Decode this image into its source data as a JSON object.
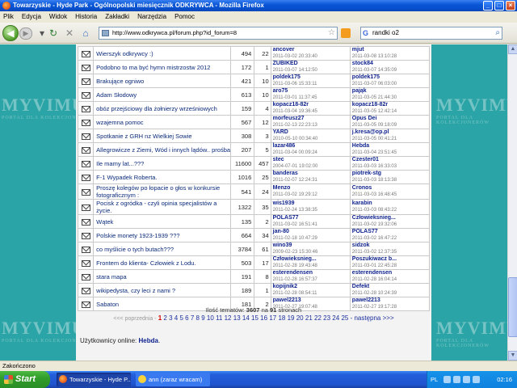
{
  "window": {
    "title": "Towarzyskie - Hyde Park - Ogólnopolski miesięcznik ODKRYWCA - Mozilla Firefox"
  },
  "menu": [
    "Plik",
    "Edycja",
    "Widok",
    "Historia",
    "Zakładki",
    "Narzędzia",
    "Pomoc"
  ],
  "toolbar": {
    "url": "http://www.odkrywca.pl/forum.php?id_forum=8",
    "search_value": "randki o2"
  },
  "side_logo": {
    "main": "MYVIMU",
    "sub": "PORTAL DLA KOLEKCJONERÓW"
  },
  "topics": [
    {
      "title": "Wierszyk odkrywcy :)",
      "views": "494",
      "replies": "22",
      "author": "ancover",
      "author_date": "2011-03-02 20:33:40",
      "last": "mjut",
      "last_date": "2011-03-08 13:10:28"
    },
    {
      "title": "Podobno to ma być hymn mistrzostw 2012",
      "views": "172",
      "replies": "1",
      "author": "ZUBIKED",
      "author_date": "2011-03-07 14:12:50",
      "last": "stock84",
      "last_date": "2011-03-07 14:35:09"
    },
    {
      "title": "Brakujące ogniwo",
      "views": "421",
      "replies": "10",
      "author": "poldek175",
      "author_date": "2011-03-06 15:33:11",
      "last": "poldek175",
      "last_date": "2011-03-07 06:03:00"
    },
    {
      "title": "Adam Słodowy",
      "views": "613",
      "replies": "10",
      "author": "aro75",
      "author_date": "2011-03-01 11:37:45",
      "last": "pająk",
      "last_date": "2011-03-05 21:44:30"
    },
    {
      "title": "obóz przejściowy dla żołnierzy wrześniowych",
      "views": "159",
      "replies": "4",
      "author": "kopacz18-82r",
      "author_date": "2011-03-04 19:36:45",
      "last": "kopacz18-82r",
      "last_date": "2011-03-05 12:42:14"
    },
    {
      "title": "wzajemna pomoc",
      "views": "567",
      "replies": "12",
      "author": "morfeusz27",
      "author_date": "2011-02-13 22:23:13",
      "last": "Opus Dei",
      "last_date": "2011-03-05 09:18:09"
    },
    {
      "title": "Spotkanie z GRH nz Wielkiej Sowie",
      "views": "308",
      "replies": "3",
      "author": "YARD",
      "author_date": "2010-05-10 00:34:40",
      "last": "j.kresa@op.pl",
      "last_date": "2011-03-05 00:41:21"
    },
    {
      "title": "Allegrowicze z Ziemi, Wód i innych lądów.. prośba",
      "views": "207",
      "replies": "5",
      "author": "lazar486",
      "author_date": "2011-03-04 00:09:24",
      "last": "Hebda",
      "last_date": "2011-03-04 23:51:45"
    },
    {
      "title": "Ile mamy lat...???",
      "views": "11600",
      "replies": "457",
      "author": "stec",
      "author_date": "2004-07-01 19:02:00",
      "last": "Czester01",
      "last_date": "2011-03-03 16:33:03"
    },
    {
      "title": "F-1 Wypadek Roberta.",
      "views": "1016",
      "replies": "25",
      "author": "banderas",
      "author_date": "2011-02-07 12:24:31",
      "last": "piotrek-stg",
      "last_date": "2011-03-03 18:13:38"
    },
    {
      "title": "Proszę kolegów po łopacie o głos w konkursie fotograficznym :",
      "views": "541",
      "replies": "24",
      "author": "Menzo",
      "author_date": "2011-03-02 19:29:12",
      "last": "Cronos",
      "last_date": "2011-03-03 16:48:45"
    },
    {
      "title": "Pocisk z ogródka - czyli opinia specjalistów a życie.",
      "views": "1322",
      "replies": "35",
      "author": "wis1939",
      "author_date": "2011-02-24 13:38:35",
      "last": "karabin",
      "last_date": "2011-03-03 08:43:22"
    },
    {
      "title": "Wątek",
      "views": "135",
      "replies": "2",
      "author": "POLAS77",
      "author_date": "2011-03-02 16:51:41",
      "last": "Człowieksnieg...",
      "last_date": "2011-03-02 19:32:06"
    },
    {
      "title": "Polskie monety 1923-1939 ???",
      "views": "664",
      "replies": "34",
      "author": "jan-80",
      "author_date": "2011-02-18 10:47:29",
      "last": "POLAS77",
      "last_date": "2011-03-02 16:47:22"
    },
    {
      "title": "co myślicie o tych butach???",
      "views": "3784",
      "replies": "61",
      "author": "wino39",
      "author_date": "2009-02-23 15:30:46",
      "last": "sidzok",
      "last_date": "2011-03-02 12:37:35"
    },
    {
      "title": "Frontem do klienta- Człowiek z Lodu.",
      "views": "503",
      "replies": "17",
      "author": "Człowieksnieg...",
      "author_date": "2011-02-28 19:43:48",
      "last": "Poszukiwacz b...",
      "last_date": "2011-03-01 22:45:28"
    },
    {
      "title": "stara mapa",
      "views": "191",
      "replies": "8",
      "author": "esterendensen",
      "author_date": "2011-02-28 16:57:37",
      "last": "esterendensen",
      "last_date": "2011-02-28 16:04:14"
    },
    {
      "title": "wikipedysta, czy leci z nami ?",
      "views": "189",
      "replies": "1",
      "author": "kopijnik2",
      "author_date": "2011-02-28 08:54:11",
      "last": "Defekt",
      "last_date": "2011-02-28 10:24:39"
    },
    {
      "title": "Sabaton",
      "views": "181",
      "replies": "2",
      "author": "pawel2213",
      "author_date": "2011-02-27 19:07:48",
      "last": "pawel2213",
      "last_date": "2011-02-27 19:17:28"
    }
  ],
  "summary": {
    "prefix": "Ilość tematów:",
    "count": "3607",
    "middle": "na",
    "pages": "91",
    "suffix": "stronach"
  },
  "pager": {
    "prev": "<<< poprzednia -",
    "current": "1",
    "pages": [
      "2",
      "3",
      "4",
      "5",
      "6",
      "7",
      "8",
      "9",
      "10",
      "11",
      "12",
      "13",
      "14",
      "15",
      "16",
      "17",
      "18",
      "19",
      "20",
      "21",
      "22",
      "23",
      "24",
      "25"
    ],
    "next": "- następna >>>"
  },
  "online": {
    "label": "Użytkownicy online:",
    "users": "Hebda",
    "end": "."
  },
  "statusbar": {
    "text": "Zakończono"
  },
  "taskbar": {
    "start": "Start",
    "tasks": [
      "Towarzyskie - Hyde P...",
      "ann (zaraz wracam)"
    ],
    "lang": "PL",
    "clock": "02:16"
  }
}
